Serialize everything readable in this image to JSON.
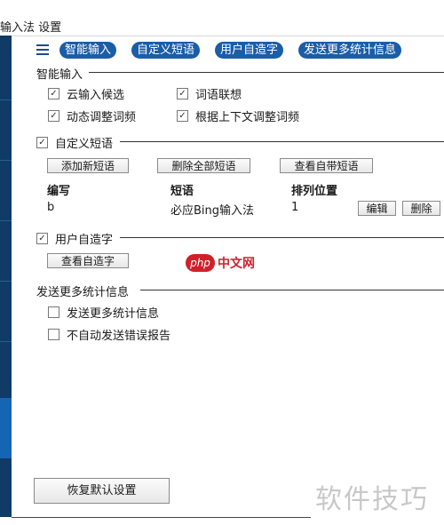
{
  "window": {
    "title": "输入法 设置"
  },
  "toolbar": {
    "menu_icon": "hamburger-menu-icon",
    "tabs": [
      {
        "label": "智能输入"
      },
      {
        "label": "自定义短语"
      },
      {
        "label": "用户自造字"
      },
      {
        "label": "发送更多统计信息"
      }
    ],
    "accent_color": "#1a5da8"
  },
  "smart_input": {
    "title": "智能输入",
    "options": [
      {
        "label": "云输入候选",
        "checked": true
      },
      {
        "label": "词语联想",
        "checked": true
      },
      {
        "label": "动态调整词频",
        "checked": true
      },
      {
        "label": "根据上下文调整词频",
        "checked": true
      }
    ]
  },
  "custom_phrase": {
    "title": "自定义短语",
    "checked": true,
    "buttons": {
      "add": "添加新短语",
      "delete_all": "删除全部短语",
      "view_builtin": "查看自带短语"
    },
    "table": {
      "headers": [
        "编写",
        "短语",
        "排列位置"
      ],
      "rows": [
        {
          "code": "b",
          "phrase": "必应Bing输入法",
          "position": "1",
          "edit": "编辑",
          "delete": "删除"
        }
      ]
    }
  },
  "user_chars": {
    "title": "用户自造字",
    "checked": true,
    "view_button": "查看自造字"
  },
  "statistics": {
    "title": "发送更多统计信息",
    "options": [
      {
        "label": "发送更多统计信息",
        "checked": false
      },
      {
        "label": "不自动发送错误报告",
        "checked": false
      }
    ]
  },
  "footer": {
    "restore_button": "恢复默认设置"
  },
  "watermarks": {
    "php_logo": "php",
    "php_text": "中文网",
    "bottom": "软件技巧"
  }
}
